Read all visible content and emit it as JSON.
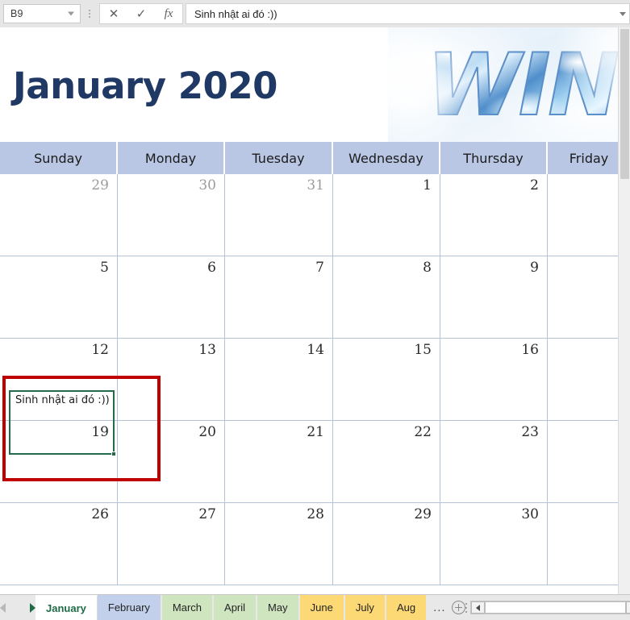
{
  "formula_bar": {
    "name_box_value": "B9",
    "name_box_dropdown_icon": "chevron-down-icon",
    "cancel_icon": "close-icon",
    "confirm_icon": "check-icon",
    "function_icon": "fx-icon",
    "function_label": "fx",
    "formula_value": "Sinh nhật ai đó :))",
    "expand_icon": "chevron-down-icon"
  },
  "calendar": {
    "title": "January 2020",
    "banner_art_text": "WIN",
    "banner_art_name": "winter-title-image",
    "day_headers": [
      "Sunday",
      "Monday",
      "Tuesday",
      "Wednesday",
      "Thursday",
      "Friday"
    ],
    "weeks": [
      [
        {
          "num": "29",
          "muted": true,
          "note": ""
        },
        {
          "num": "30",
          "muted": true,
          "note": ""
        },
        {
          "num": "31",
          "muted": true,
          "note": ""
        },
        {
          "num": "1",
          "muted": false,
          "note": ""
        },
        {
          "num": "2",
          "muted": false,
          "note": ""
        },
        {
          "num": "",
          "muted": false,
          "note": ""
        }
      ],
      [
        {
          "num": "5",
          "muted": false,
          "note": ""
        },
        {
          "num": "6",
          "muted": false,
          "note": ""
        },
        {
          "num": "7",
          "muted": false,
          "note": ""
        },
        {
          "num": "8",
          "muted": false,
          "note": ""
        },
        {
          "num": "9",
          "muted": false,
          "note": ""
        },
        {
          "num": "",
          "muted": false,
          "note": ""
        }
      ],
      [
        {
          "num": "12",
          "muted": false,
          "note": "Sinh nhật ai đó :))"
        },
        {
          "num": "13",
          "muted": false,
          "note": ""
        },
        {
          "num": "14",
          "muted": false,
          "note": ""
        },
        {
          "num": "15",
          "muted": false,
          "note": ""
        },
        {
          "num": "16",
          "muted": false,
          "note": ""
        },
        {
          "num": "",
          "muted": false,
          "note": ""
        }
      ],
      [
        {
          "num": "19",
          "muted": false,
          "note": ""
        },
        {
          "num": "20",
          "muted": false,
          "note": ""
        },
        {
          "num": "21",
          "muted": false,
          "note": ""
        },
        {
          "num": "22",
          "muted": false,
          "note": ""
        },
        {
          "num": "23",
          "muted": false,
          "note": ""
        },
        {
          "num": "",
          "muted": false,
          "note": ""
        }
      ],
      [
        {
          "num": "26",
          "muted": false,
          "note": ""
        },
        {
          "num": "27",
          "muted": false,
          "note": ""
        },
        {
          "num": "28",
          "muted": false,
          "note": ""
        },
        {
          "num": "29",
          "muted": false,
          "note": ""
        },
        {
          "num": "30",
          "muted": false,
          "note": ""
        },
        {
          "num": "",
          "muted": false,
          "note": ""
        }
      ]
    ]
  },
  "selection": {
    "cell_text": "Sinh nhật ai đó :))",
    "selection_border_color": "#236b4b",
    "annotation_border_color": "#c00000"
  },
  "tabs": {
    "nav_prev_icon": "triangle-left-icon",
    "nav_next_icon": "triangle-right-icon",
    "items": [
      {
        "label": "January",
        "color": "#ffffff",
        "active": true
      },
      {
        "label": "February",
        "color": "#c2d0ec",
        "active": false
      },
      {
        "label": "March",
        "color": "#cfe5c0",
        "active": false
      },
      {
        "label": "April",
        "color": "#cfe5c0",
        "active": false
      },
      {
        "label": "May",
        "color": "#cfe5c0",
        "active": false
      },
      {
        "label": "June",
        "color": "#fcd974",
        "active": false
      },
      {
        "label": "July",
        "color": "#fcd974",
        "active": false
      },
      {
        "label": "Aug",
        "color": "#fcd974",
        "active": false
      }
    ],
    "overflow_label": "...",
    "add_sheet_icon": "plus-circle-icon",
    "scroll_left_icon": "triangle-left-icon",
    "scroll_right_icon": "triangle-right-icon"
  },
  "theme": {
    "title_color": "#1f3864",
    "header_bg": "#b9c7e4",
    "grid_line": "#b6c2d6",
    "active_tab_text": "#1e6b46"
  }
}
